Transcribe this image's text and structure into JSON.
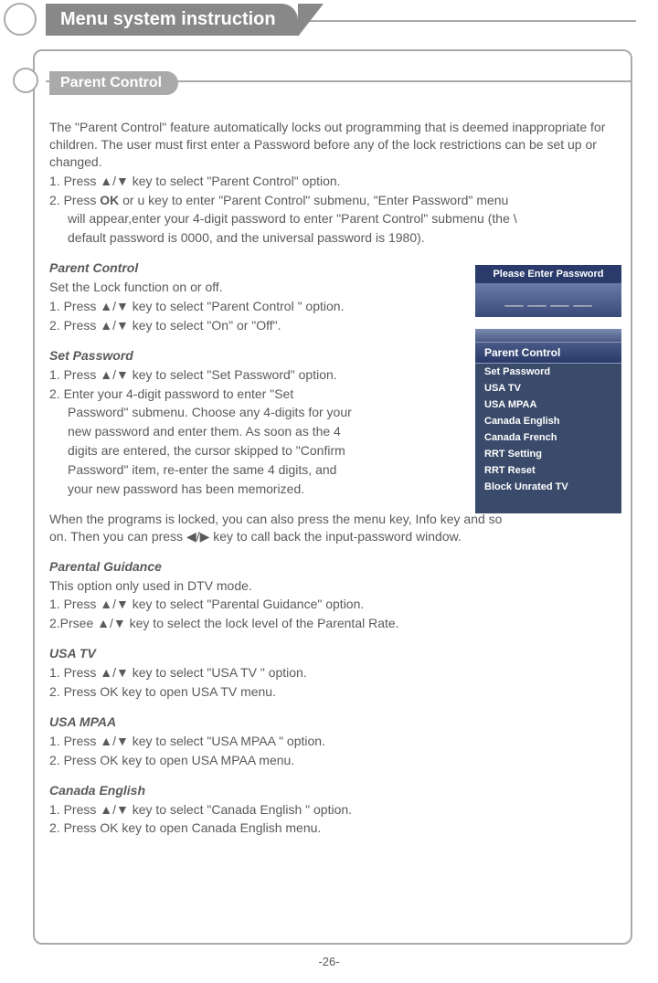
{
  "header": {
    "title": "Menu system instruction",
    "subtitle": "Parent  Control"
  },
  "intro": {
    "p1": "The \"Parent  Control\" feature automatically locks out programming that is deemed inappropriate for children. The user must first enter a Password before any of the lock restrictions can be set up or changed.",
    "s1": "1. Press ▲/▼ key to select \"Parent  Control\" option.",
    "s2a": "2. Press ",
    "s2b": "OK",
    "s2c": " or u key to enter \"Parent  Control\" submenu, \"Enter Password\" menu",
    "s2d": "will appear,enter your 4-digit password to enter \"Parent  Control\" submenu (the \\",
    "s2e": "default password  is  0000, and the  universal password is 1980)."
  },
  "parentControl": {
    "title": "Parent  Control",
    "d": "Set the Lock function on or off.",
    "s1": "1. Press ▲/▼ key to select \"Parent  Control \" option.",
    "s2": "2. Press ▲/▼ key to select \"On\" or \"Off\"."
  },
  "setPassword": {
    "title": "Set Password",
    "s1": "1. Press ▲/▼ key to select \"Set Password\" option.",
    "s2a": "2. Enter your 4-digit password to enter  \"Set",
    "s2b": "Password\" submenu. Choose any 4-digits for your",
    "s2c": "new password and enter them. As soon as the 4",
    "s2d": "digits are entered, the cursor skipped to \"Confirm",
    "s2e": "Password\" item, re-enter the same 4 digits, and",
    "s2f": "your new password has been memorized."
  },
  "locked": {
    "p1": "When the programs is locked, you can also press the menu key, Info key and so on. Then you can press ◀/▶ key  to call back the input-password window."
  },
  "parentalGuidance": {
    "title": "Parental Guidance",
    "d": "This option only used in DTV mode.",
    "s1": "1. Press ▲/▼ key to select \"Parental Guidance\" option.",
    "s2": "2.Prsee ▲/▼ key  to select the lock level of the Parental Rate."
  },
  "usaTv": {
    "title": "USA TV",
    "s1": "1. Press ▲/▼ key to select \"USA TV \" option.",
    "s2": "2. Press OK key to open USA TV menu."
  },
  "usaMpaa": {
    "title": "USA MPAA",
    "s1": "1. Press ▲/▼ key to select \"USA MPAA \" option.",
    "s2": "2. Press OK key to open USA MPAA menu."
  },
  "canadaEnglish": {
    "title": "Canada English",
    "s1": "1. Press ▲/▼ key to select \"Canada English \" option.",
    "s2": "2. Press OK key to open Canada English menu."
  },
  "passwordDialog": {
    "header": "Please Enter Password",
    "body": "__  __  __  __"
  },
  "menu": {
    "title": "Parent  Control",
    "items": [
      "Set Password",
      "USA TV",
      "USA MPAA",
      "Canada English",
      "Canada French",
      "RRT Setting",
      "RRT Reset",
      "Block Unrated TV"
    ]
  },
  "footer": {
    "page": "-26-"
  }
}
